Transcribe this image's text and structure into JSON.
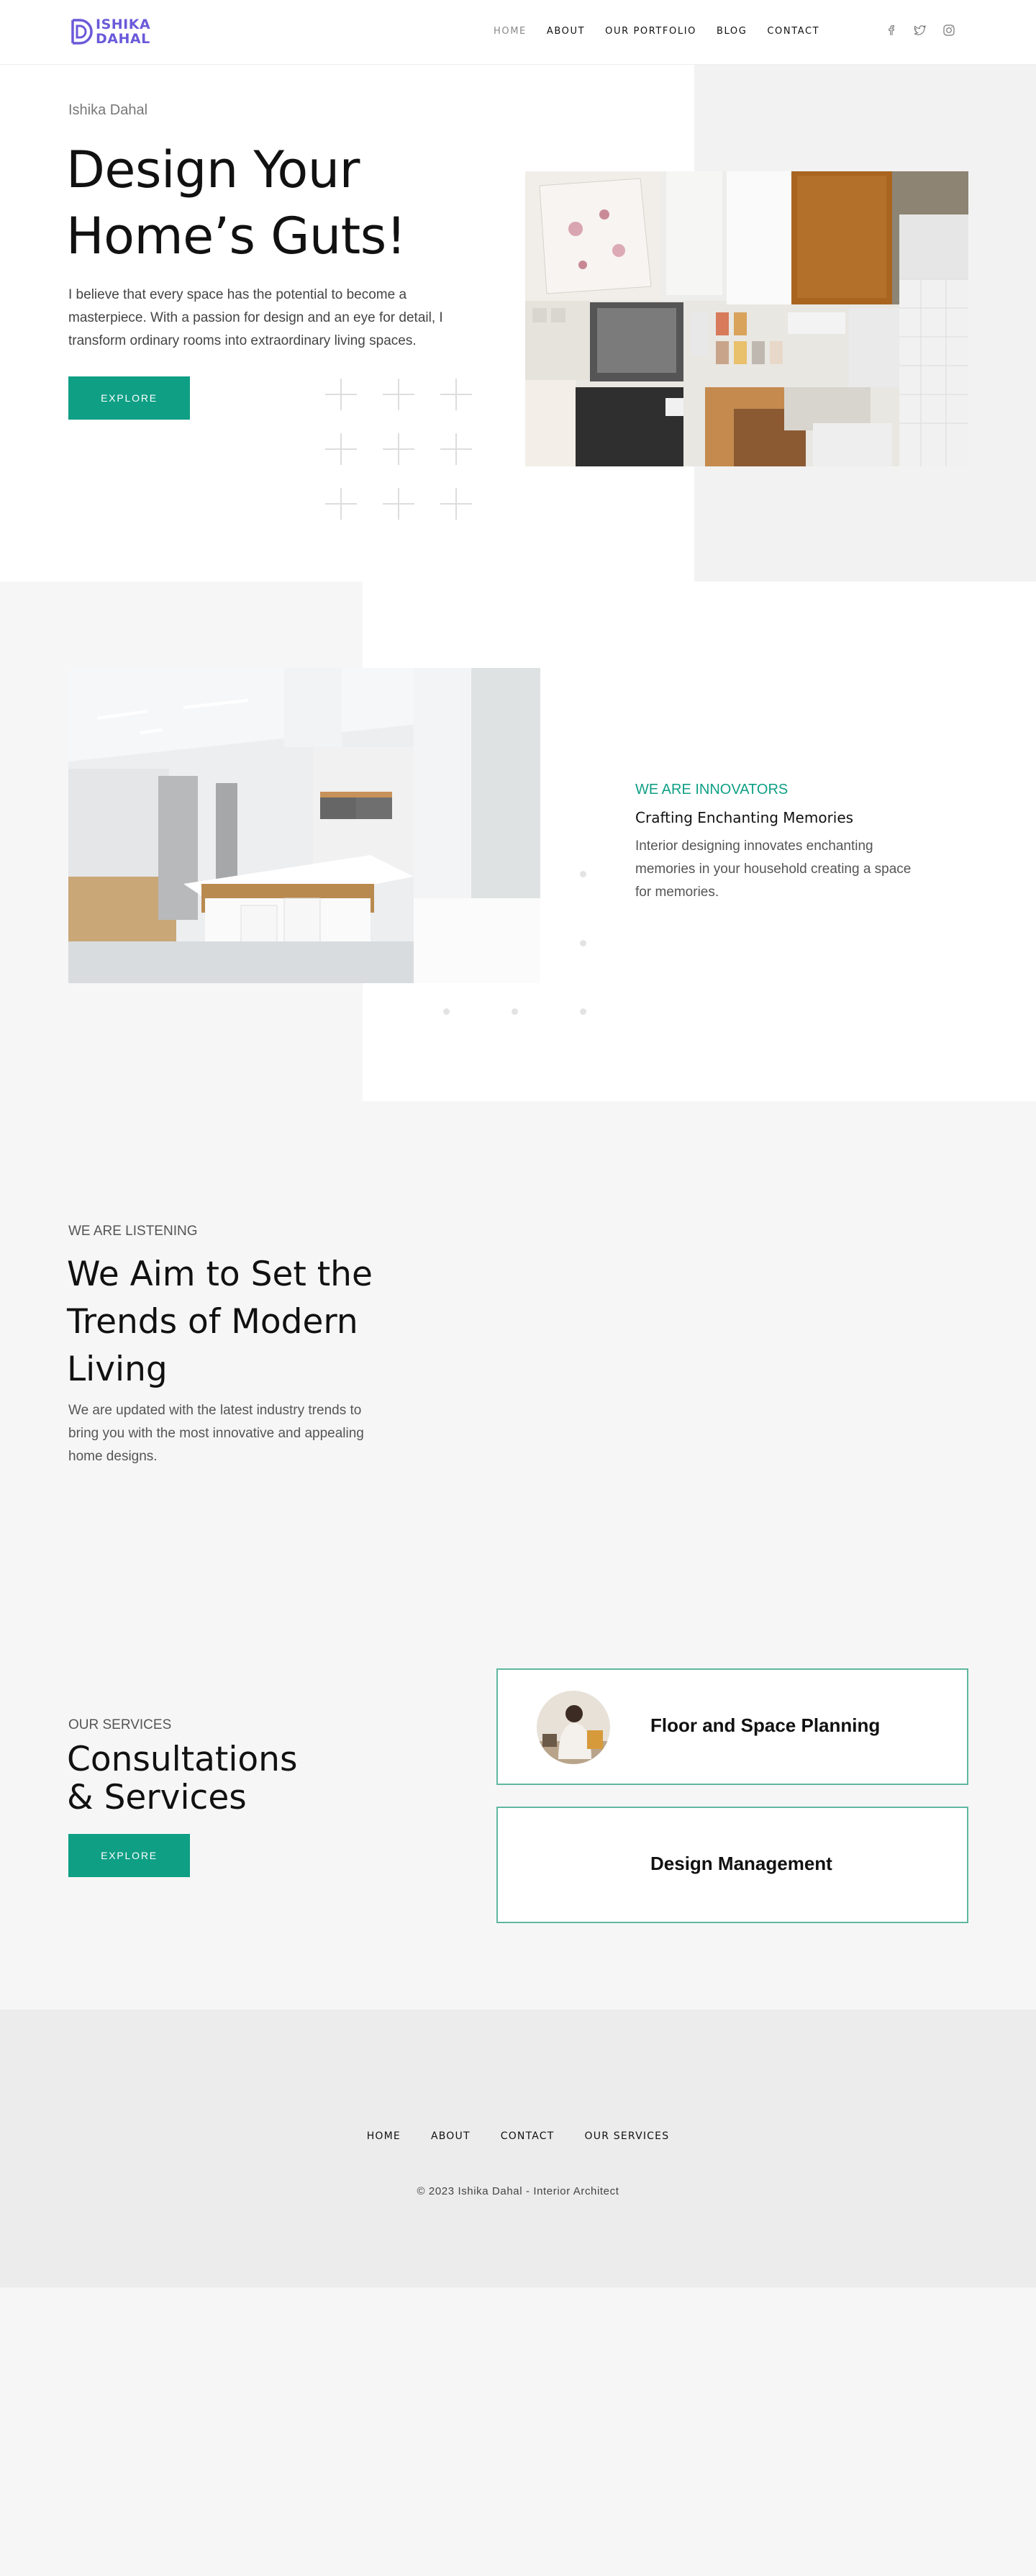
{
  "header": {
    "logo_text_line1": "ISHIKA",
    "logo_text_line2": "DAHAL",
    "nav": [
      {
        "label": "HOME",
        "active": true
      },
      {
        "label": "ABOUT"
      },
      {
        "label": "OUR PORTFOLIO"
      },
      {
        "label": "BLOG"
      },
      {
        "label": "CONTACT"
      }
    ],
    "social_icons": [
      "facebook-icon",
      "twitter-icon",
      "instagram-icon"
    ]
  },
  "hero": {
    "kicker": "Ishika Dahal",
    "title": "Design Your Home’s Guts!",
    "description": "I believe that every space has the potential to become a masterpiece. With a passion for design and an eye for detail, I transform ordinary rooms into extraordinary living spaces.",
    "button": "EXPLORE"
  },
  "innovators": {
    "kicker": "WE ARE INNOVATORS",
    "subtitle": "Crafting Enchanting Memories",
    "description": "Interior designing innovates enchanting memories in your household creating a space for memories."
  },
  "listening": {
    "kicker": "WE ARE LISTENING",
    "title": "We Aim to Set the Trends of Modern Living",
    "description": "We are updated with the latest industry trends to bring you with the most innovative and appealing home designs."
  },
  "services": {
    "kicker": "OUR SERVICES",
    "title_line1": "Consultations",
    "title_line2": "& Services",
    "button": "EXPLORE",
    "cards": [
      {
        "label": "Floor and Space Planning"
      },
      {
        "label": "Design Management"
      }
    ]
  },
  "footer": {
    "nav": [
      "HOME",
      "ABOUT",
      "CONTACT",
      "OUR SERVICES"
    ],
    "copyright": "© 2023 Ishika Dahal - Interior Architect"
  },
  "colors": {
    "accent": "#0e9f85",
    "logo": "#6a5ad9",
    "card_border": "#5fb79f"
  }
}
